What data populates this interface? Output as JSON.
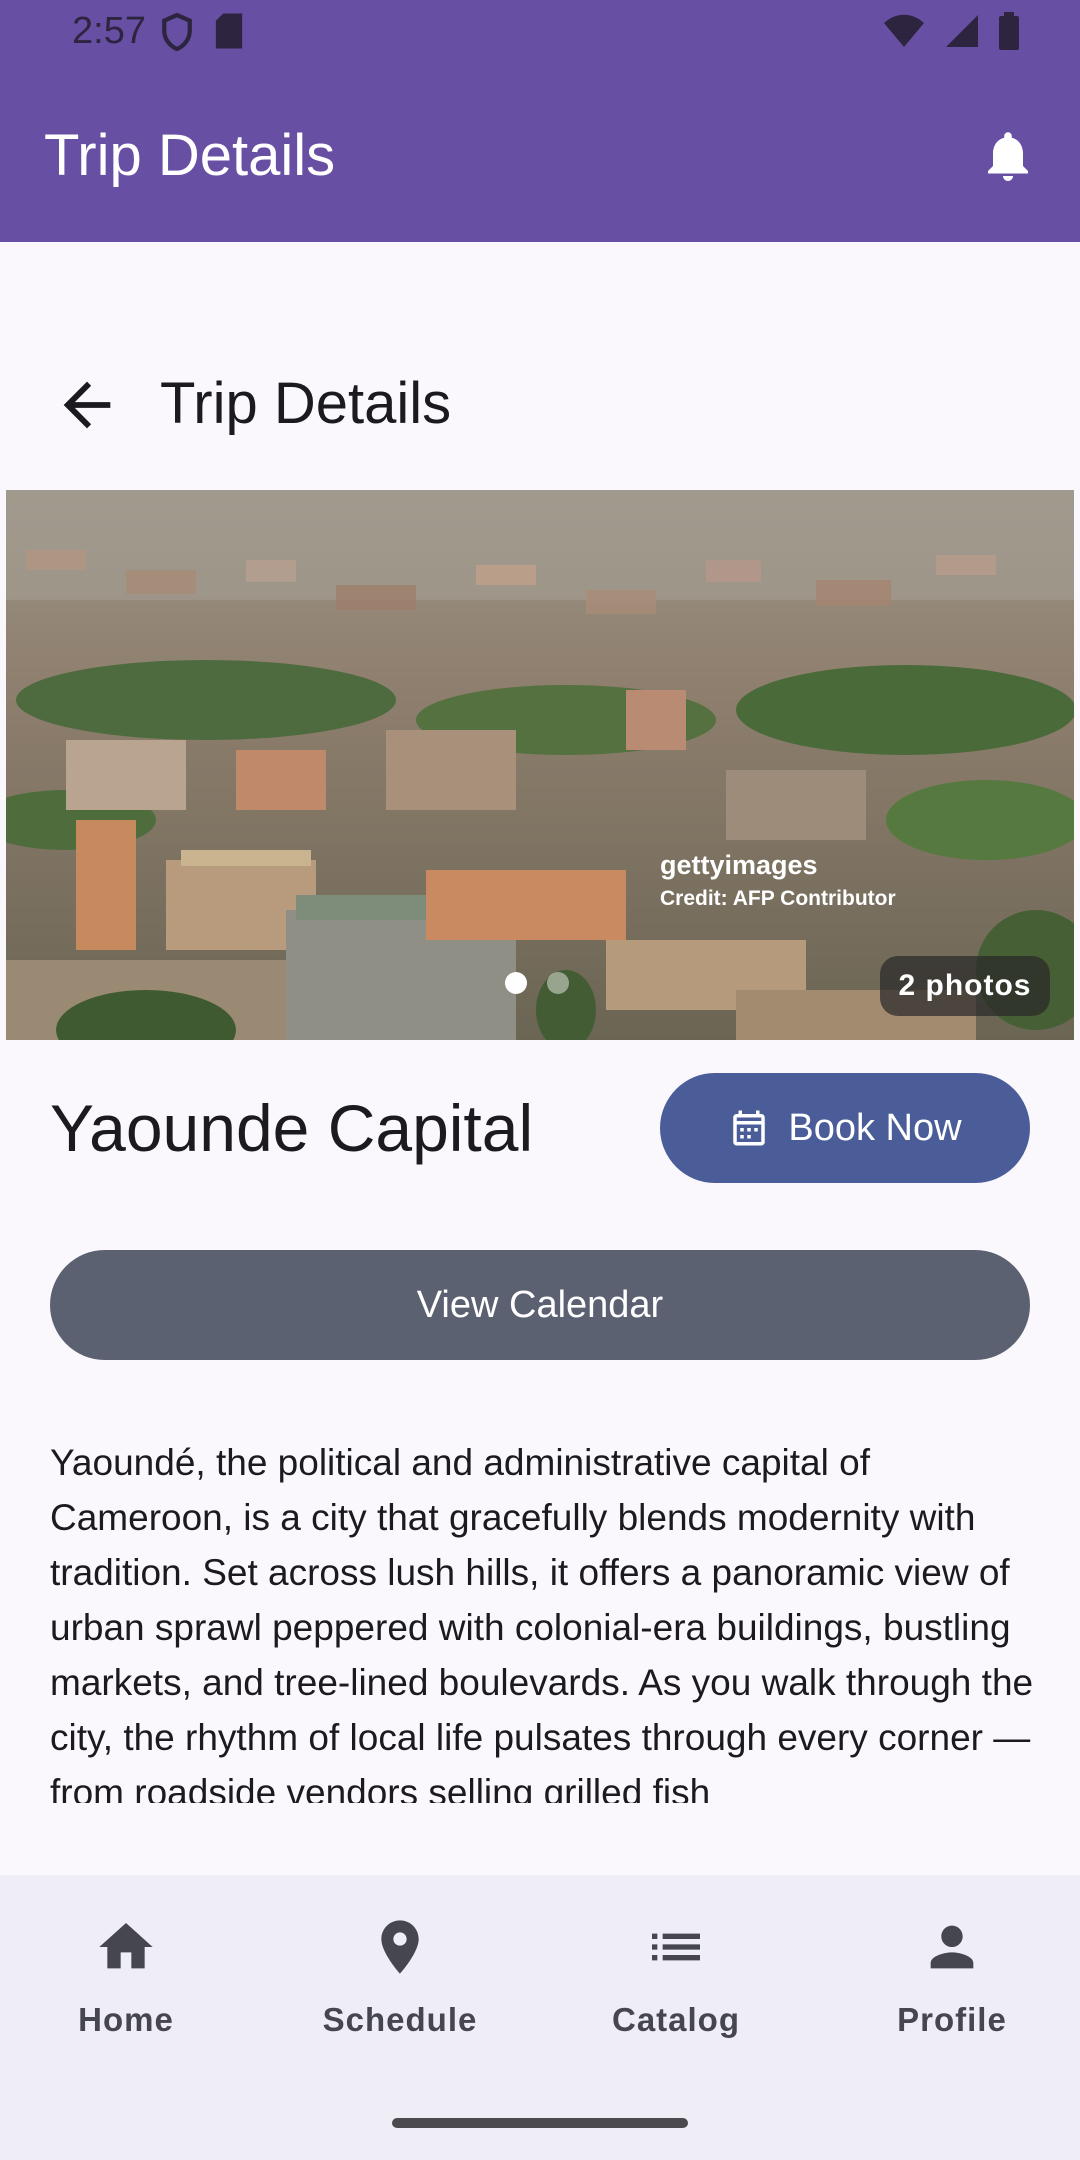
{
  "status_bar": {
    "time": "2:57"
  },
  "app_bar": {
    "title": "Trip Details"
  },
  "subheader": {
    "title": "Trip Details"
  },
  "hero": {
    "watermark_brand": "gettyimages",
    "watermark_credit": "Credit: AFP Contributor",
    "photo_count": "2 photos",
    "current_page": 1,
    "total_pages": 2
  },
  "place": {
    "name": "Yaounde Capital",
    "book_label": "Book Now",
    "calendar_label": "View Calendar",
    "description": "Yaoundé, the political and administrative capital of Cameroon, is a city that gracefully blends modernity with tradition. Set across lush hills, it offers a panoramic view of urban sprawl peppered with colonial-era buildings, bustling markets, and tree-lined boulevards. As you walk through the city, the rhythm of local life pulsates through every corner — from roadside vendors selling grilled fish"
  },
  "bottom_nav": {
    "items": [
      {
        "label": "Home",
        "icon": "home-icon"
      },
      {
        "label": "Schedule",
        "icon": "location-pin-icon"
      },
      {
        "label": "Catalog",
        "icon": "list-icon"
      },
      {
        "label": "Profile",
        "icon": "person-icon"
      }
    ]
  },
  "colors": {
    "primary": "#6750a4",
    "book_button": "#4a5d99",
    "calendar_button": "#5c6172",
    "nav_background": "#efedf5"
  }
}
